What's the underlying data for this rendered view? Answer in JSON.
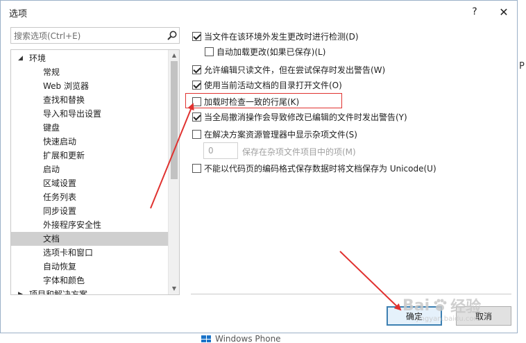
{
  "dialog": {
    "title": "选项",
    "help_label": "?",
    "close_label": "✕"
  },
  "search": {
    "placeholder": "搜索选项(Ctrl+E)"
  },
  "tree": {
    "root_label": "环境",
    "items": [
      {
        "label": "常规"
      },
      {
        "label": "Web 浏览器"
      },
      {
        "label": "查找和替换"
      },
      {
        "label": "导入和导出设置"
      },
      {
        "label": "键盘"
      },
      {
        "label": "快速启动"
      },
      {
        "label": "扩展和更新"
      },
      {
        "label": "启动"
      },
      {
        "label": "区域设置"
      },
      {
        "label": "任务列表"
      },
      {
        "label": "同步设置"
      },
      {
        "label": "外接程序安全性"
      },
      {
        "label": "文档",
        "selected": true
      },
      {
        "label": "选项卡和窗口"
      },
      {
        "label": "自动恢复"
      },
      {
        "label": "字体和颜色"
      }
    ],
    "next_root_label": "项目和解决方案"
  },
  "options": [
    {
      "label": "当文件在该环境外发生更改时进行检测(D)",
      "checked": true,
      "enabled": true
    },
    {
      "label": "自动加载更改(如果已保存)(L)",
      "checked": false,
      "enabled": true
    },
    {
      "label": "允许编辑只读文件，但在尝试保存时发出警告(W)",
      "checked": true,
      "enabled": true
    },
    {
      "label": "使用当前活动文档的目录打开文件(O)",
      "checked": true,
      "enabled": true
    },
    {
      "label": "加载时检查一致的行尾(K)",
      "checked": false,
      "enabled": true
    },
    {
      "label": "当全局撤消操作会导致修改已编辑的文件时发出警告(Y)",
      "checked": true,
      "enabled": true
    },
    {
      "label": "在解决方案资源管理器中显示杂项文件(S)",
      "checked": false,
      "enabled": true
    },
    {
      "label": "保存在杂项文件项目中的项(M)",
      "checked": false,
      "enabled": false
    },
    {
      "label": "不能以代码页的编码格式保存数据时将文档保存为 Unicode(U)",
      "checked": false,
      "enabled": true
    }
  ],
  "misc_items_count": "0",
  "buttons": {
    "ok_label": "确定",
    "cancel_label": "取消"
  },
  "background": {
    "taskbar_item": "Windows Phone",
    "right_glyph": "P"
  },
  "watermark": {
    "brand": "Bai",
    "brand2": "经验",
    "sub": "jingyan.baidu.com"
  },
  "colors": {
    "annotation_red": "#e0312f",
    "selection_gray": "#cfcfcf",
    "ok_border": "#3c7fb1"
  }
}
